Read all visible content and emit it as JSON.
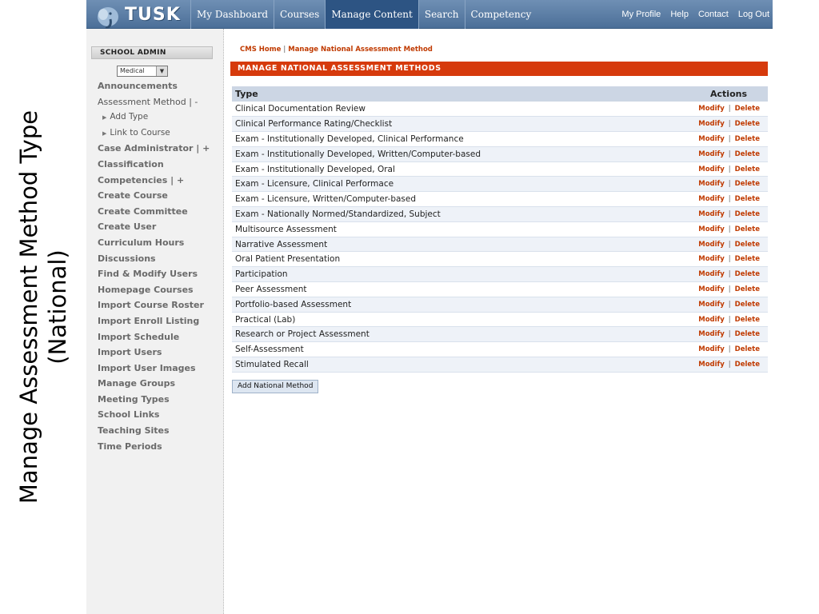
{
  "slide": {
    "title_line1": "Manage Assessment Method Type",
    "title_line2": "(National)"
  },
  "topbar": {
    "logo_text": "TUSK",
    "nav_tabs": [
      "My Dashboard",
      "Courses",
      "Manage Content",
      "Search",
      "Competency"
    ],
    "active_tab": "Manage Content",
    "util_links": [
      "My Profile",
      "Help",
      "Contact",
      "Log Out"
    ]
  },
  "sidebar": {
    "header": "SCHOOL ADMIN",
    "school_select": "Medical",
    "items": [
      {
        "label": "Announcements",
        "style": "bold"
      },
      {
        "label": "Assessment Method  |  -",
        "style": "plain"
      },
      {
        "label": "Add Type",
        "style": "sub"
      },
      {
        "label": "Link to Course",
        "style": "sub"
      },
      {
        "label": "Case Administrator  |  +",
        "style": "bold"
      },
      {
        "label": "Classification",
        "style": "bold"
      },
      {
        "label": "Competencies  |  +",
        "style": "bold"
      },
      {
        "label": "Create Course",
        "style": "bold"
      },
      {
        "label": "Create Committee",
        "style": "bold"
      },
      {
        "label": "Create User",
        "style": "bold"
      },
      {
        "label": "Curriculum Hours",
        "style": "bold"
      },
      {
        "label": "Discussions",
        "style": "bold"
      },
      {
        "label": "Find & Modify Users",
        "style": "bold"
      },
      {
        "label": "Homepage Courses",
        "style": "bold"
      },
      {
        "label": "Import Course Roster",
        "style": "bold"
      },
      {
        "label": "Import Enroll Listing",
        "style": "bold"
      },
      {
        "label": "Import Schedule",
        "style": "bold"
      },
      {
        "label": "Import Users",
        "style": "bold"
      },
      {
        "label": "Import User Images",
        "style": "bold"
      },
      {
        "label": "Manage Groups",
        "style": "bold"
      },
      {
        "label": "Meeting Types",
        "style": "bold"
      },
      {
        "label": "School Links",
        "style": "bold"
      },
      {
        "label": "Teaching Sites",
        "style": "bold"
      },
      {
        "label": "Time Periods",
        "style": "bold"
      }
    ]
  },
  "main": {
    "breadcrumb": [
      "CMS Home",
      "Manage National Assessment Method"
    ],
    "section_title": "MANAGE NATIONAL ASSESSMENT METHODS",
    "table": {
      "col_type": "Type",
      "col_actions": "Actions",
      "modify_label": "Modify",
      "delete_label": "Delete",
      "rows": [
        "Clinical Documentation Review",
        "Clinical Performance Rating/Checklist",
        "Exam - Institutionally Developed, Clinical Performance",
        "Exam - Institutionally Developed, Written/Computer-based",
        "Exam - Institutionally Developed, Oral",
        "Exam - Licensure, Clinical Performace",
        "Exam - Licensure, Written/Computer-based",
        "Exam - Nationally Normed/Standardized, Subject",
        "Multisource Assessment",
        "Narrative Assessment",
        "Oral Patient Presentation",
        "Participation",
        "Peer Assessment",
        "Portfolio-based Assessment",
        "Practical (Lab)",
        "Research or Project Assessment",
        "Self-Assessment",
        "Stimulated Recall"
      ]
    },
    "add_button": "Add National Method"
  },
  "colors": {
    "accent": "#d63a0c",
    "nav_bg": "#5a7ca4",
    "link": "#c03a00"
  }
}
